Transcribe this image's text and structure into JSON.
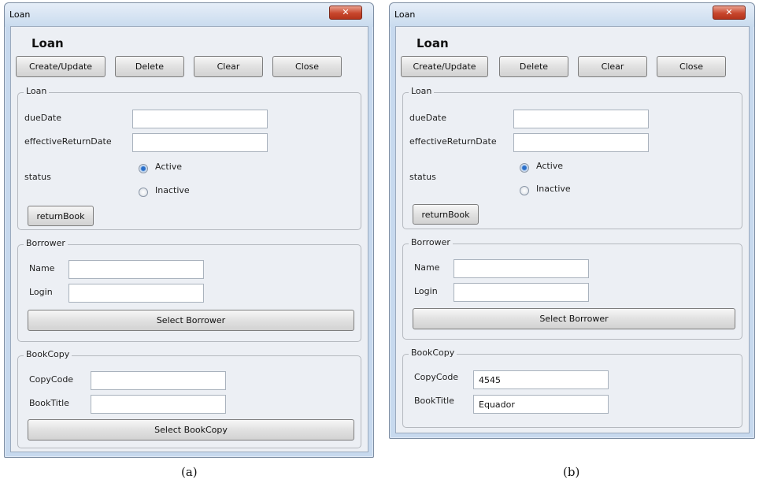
{
  "panels": [
    {
      "window_title": "Loan",
      "heading": "Loan",
      "toolbar": {
        "create_update": "Create/Update",
        "delete": "Delete",
        "clear": "Clear",
        "close": "Close"
      },
      "loan_group": {
        "legend": "Loan",
        "due_date_label": "dueDate",
        "due_date_value": "",
        "effective_return_label": "effectiveReturnDate",
        "effective_return_value": "",
        "status_label": "status",
        "status_options": [
          "Active",
          "Inactive"
        ],
        "status_selected": "Active",
        "return_book_button": "returnBook"
      },
      "borrower_group": {
        "legend": "Borrower",
        "name_label": "Name",
        "name_value": "",
        "login_label": "Login",
        "login_value": "",
        "select_button": "Select Borrower"
      },
      "bookcopy_group": {
        "legend": "BookCopy",
        "copy_code_label": "CopyCode",
        "copy_code_value": "",
        "book_title_label": "BookTitle",
        "book_title_value": "",
        "select_button": "Select BookCopy"
      },
      "caption": "(a)"
    },
    {
      "window_title": "Loan",
      "heading": "Loan",
      "toolbar": {
        "create_update": "Create/Update",
        "delete": "Delete",
        "clear": "Clear",
        "close": "Close"
      },
      "loan_group": {
        "legend": "Loan",
        "due_date_label": "dueDate",
        "due_date_value": "",
        "effective_return_label": "effectiveReturnDate",
        "effective_return_value": "",
        "status_label": "status",
        "status_options": [
          "Active",
          "Inactive"
        ],
        "status_selected": "Active",
        "return_book_button": "returnBook"
      },
      "borrower_group": {
        "legend": "Borrower",
        "name_label": "Name",
        "name_value": "",
        "login_label": "Login",
        "login_value": "",
        "select_button": "Select Borrower"
      },
      "bookcopy_group": {
        "legend": "BookCopy",
        "copy_code_label": "CopyCode",
        "copy_code_value": "4545",
        "book_title_label": "BookTitle",
        "book_title_value": "Equador"
      },
      "caption": "(b)"
    }
  ],
  "colors": {
    "window_frame": "#c7d9ee",
    "client_bg": "#eceff4",
    "close_button": "#c8472d",
    "radio_selected": "#2a6fc9"
  },
  "icons": {
    "close": "close-x-icon"
  }
}
